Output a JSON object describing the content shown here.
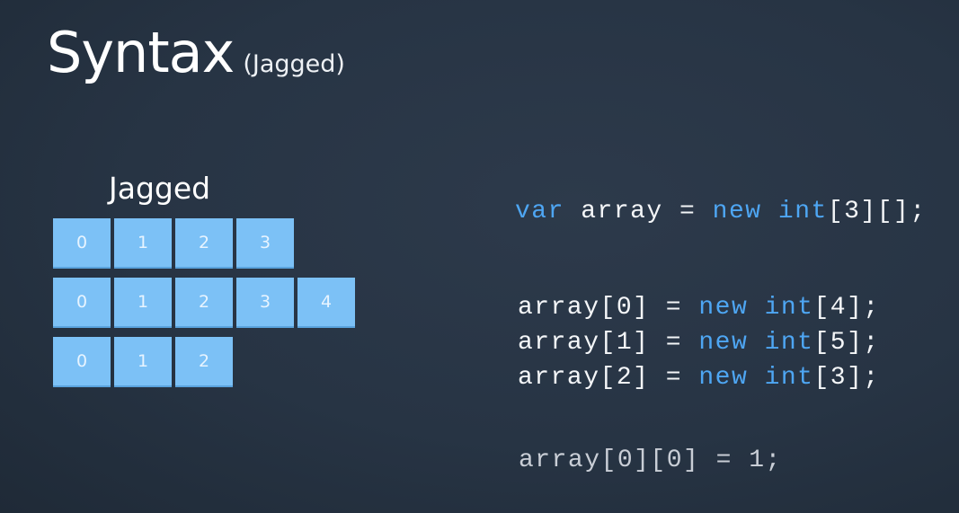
{
  "title": {
    "main": "Syntax",
    "sub": "(Jagged)"
  },
  "diagram": {
    "label": "Jagged",
    "rows": [
      [
        "0",
        "1",
        "2",
        "3"
      ],
      [
        "0",
        "1",
        "2",
        "3",
        "4"
      ],
      [
        "0",
        "1",
        "2"
      ]
    ],
    "cell_color": "#7cc1f6"
  },
  "code": {
    "declaration": {
      "kw_var": "var",
      "name": " array = ",
      "kw_new": "new",
      "space": " ",
      "kw_int": "int",
      "rest": "[3][];"
    },
    "assignments": [
      {
        "lhs": "array[0] = ",
        "kw_new": "new",
        "kw_int": "int",
        "rest": "[4];"
      },
      {
        "lhs": "array[1] = ",
        "kw_new": "new",
        "kw_int": "int",
        "rest": "[5];"
      },
      {
        "lhs": "array[2] = ",
        "kw_new": "new",
        "kw_int": "int",
        "rest": "[3];"
      }
    ],
    "access": "array[0][0] = 1;"
  },
  "colors": {
    "keyword": "#4ea6f3",
    "text": "#f4f6f8",
    "background": "#273444"
  }
}
